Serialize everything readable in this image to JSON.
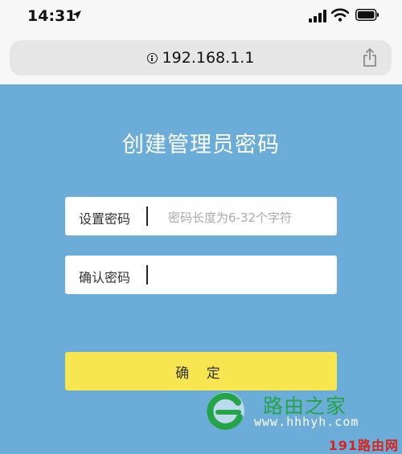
{
  "status_bar": {
    "time": "14:31"
  },
  "browser": {
    "url": "192.168.1.1"
  },
  "page": {
    "title": "创建管理员密码",
    "password_field": {
      "label": "设置密码",
      "placeholder": "密码长度为6-32个字符"
    },
    "confirm_field": {
      "label": "确认密码",
      "placeholder": ""
    },
    "confirm_button": "确 定"
  },
  "watermark": {
    "site_name": "路由之家",
    "site_url": "www.hhhyh.com",
    "corner_text": "191路由网"
  },
  "colors": {
    "background": "#6badd8",
    "button": "#f7e650",
    "watermark_green": "#25a447",
    "watermark_red": "#d8231f"
  },
  "icons": [
    "location-arrow-icon",
    "signal-icon",
    "wifi-icon",
    "battery-icon",
    "info-icon",
    "share-icon",
    "watermark-logo-icon"
  ]
}
